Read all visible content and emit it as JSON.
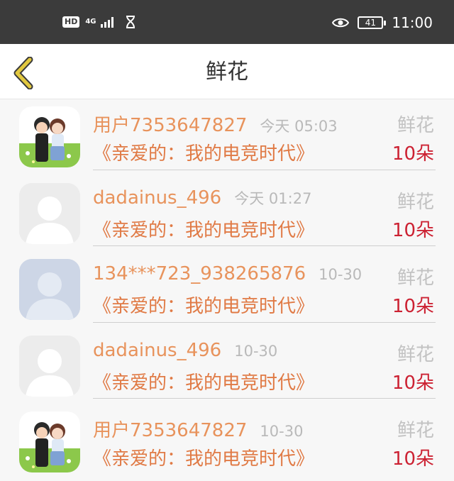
{
  "status_bar": {
    "hd": "HD",
    "network": "4G",
    "battery": "41",
    "time": "11:00"
  },
  "header": {
    "title": "鲜花"
  },
  "items": [
    {
      "username": "用户7353647827",
      "time": "今天 05:03",
      "book": "《亲爱的：我的电竞时代》",
      "gift": "鲜花",
      "count": "10朵",
      "avatar": "cartoon-couple"
    },
    {
      "username": "dadainus_496",
      "time": "今天 01:27",
      "book": "《亲爱的：我的电竞时代》",
      "gift": "鲜花",
      "count": "10朵",
      "avatar": "default-gray"
    },
    {
      "username": "134***723_938265876",
      "time": "10-30",
      "book": "《亲爱的：我的电竞时代》",
      "gift": "鲜花",
      "count": "10朵",
      "avatar": "default-blue"
    },
    {
      "username": "dadainus_496",
      "time": "10-30",
      "book": "《亲爱的：我的电竞时代》",
      "gift": "鲜花",
      "count": "10朵",
      "avatar": "default-gray"
    },
    {
      "username": "用户7353647827",
      "time": "10-30",
      "book": "《亲爱的：我的电竞时代》",
      "gift": "鲜花",
      "count": "10朵",
      "avatar": "cartoon-couple"
    }
  ],
  "colors": {
    "username": "#e8935c",
    "book_title": "#e07a45",
    "count": "#cc2233",
    "status_bar_bg": "#3b3b3b",
    "back_chevron": "#d9c03a"
  }
}
